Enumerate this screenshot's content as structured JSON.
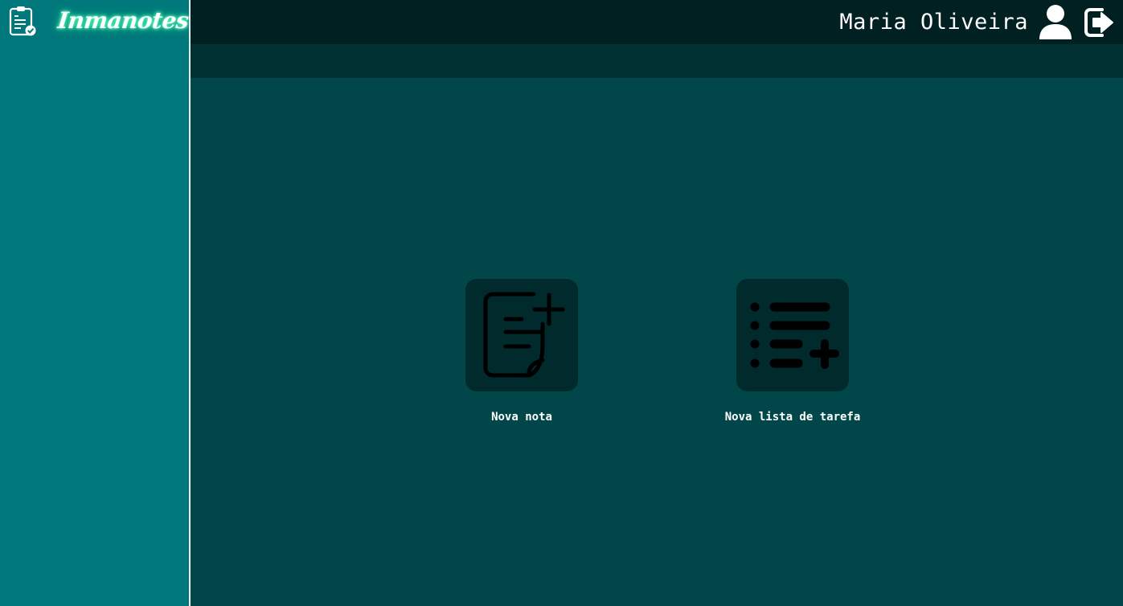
{
  "app": {
    "brand_name": "Inmanotes",
    "logo_icon": "clipboard-check-icon"
  },
  "header": {
    "user_name": "Maria Oliveira",
    "avatar_icon": "user-icon",
    "logout_icon": "logout-icon"
  },
  "colors": {
    "sidebar": "#00777a",
    "topbar": "#012022",
    "subbar": "#013132",
    "main": "#014749",
    "tile": "#012a2c",
    "brand_glow": "#1ee39a"
  },
  "actions": [
    {
      "label": "Nova nota",
      "icon": "note-add-icon"
    },
    {
      "label": "Nova lista de tarefa",
      "icon": "list-add-icon"
    }
  ]
}
